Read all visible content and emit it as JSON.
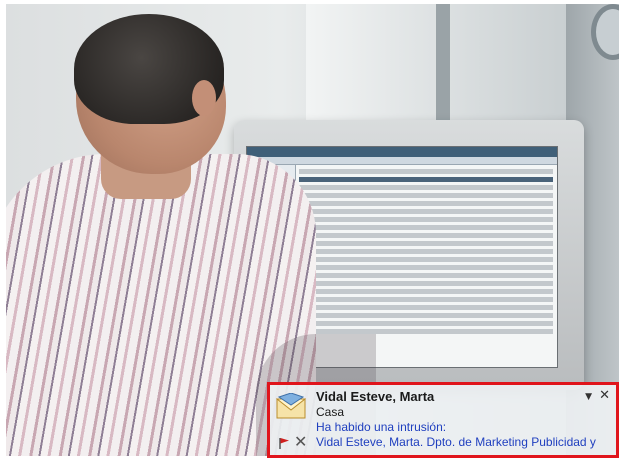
{
  "notification": {
    "sender": "Vidal Esteve, Marta",
    "subject": "Casa",
    "body_line1": "Ha habido una intrusión:",
    "body_line2": "Vidal Esteve, Marta.  Dpto. de Marketing Publicidad y",
    "icons": {
      "mail": "envelope-icon",
      "flag": "flag-icon",
      "delete": "delete-icon",
      "options": "dropdown-icon",
      "close": "close-icon"
    },
    "colors": {
      "highlight_border": "#e0151c",
      "link_text": "#1f3fbf"
    }
  }
}
